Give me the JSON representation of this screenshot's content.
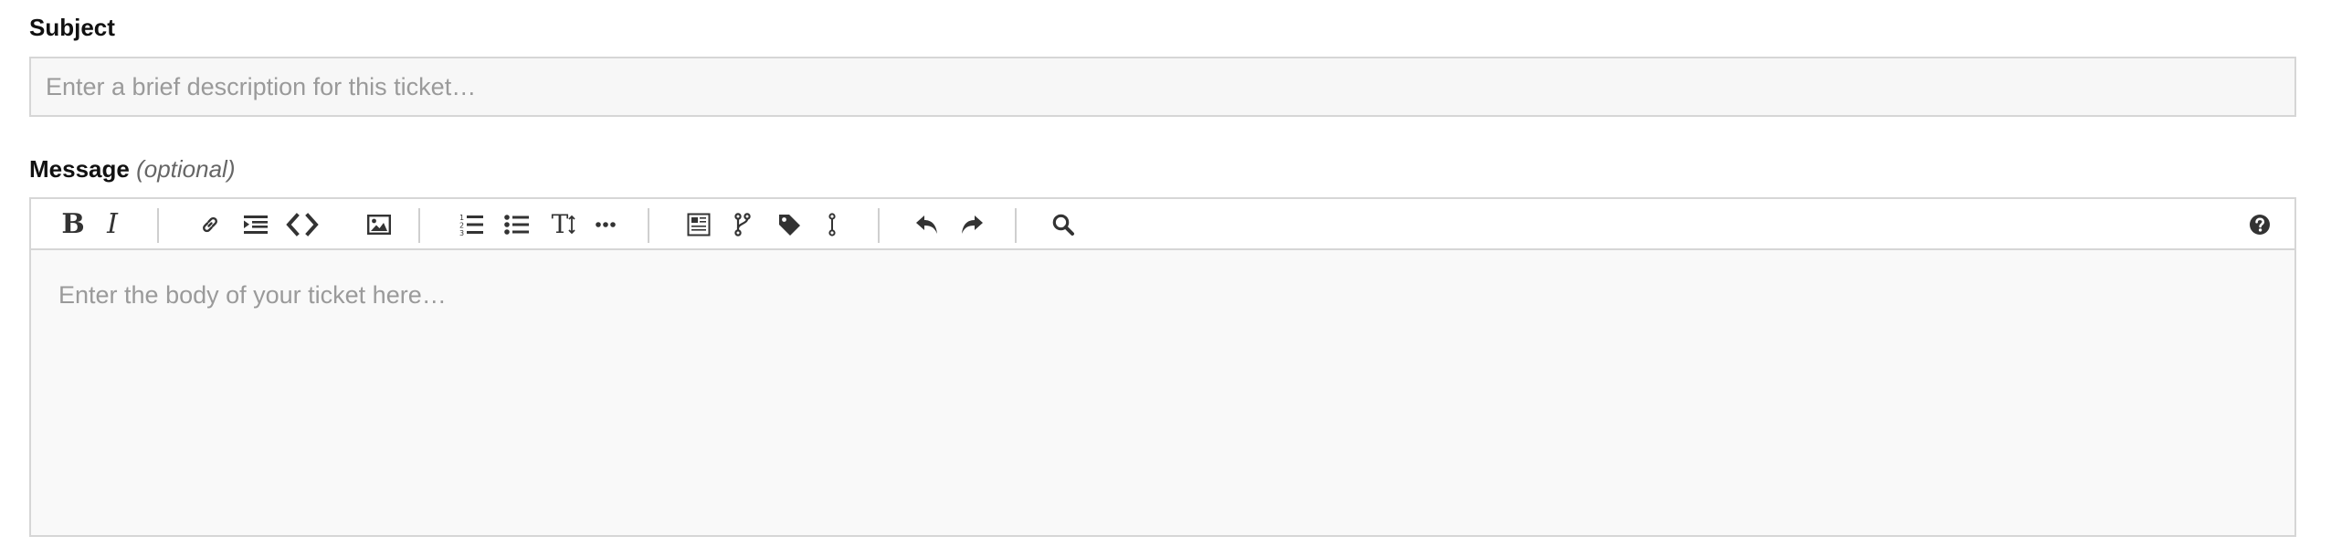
{
  "subject": {
    "label": "Subject",
    "placeholder": "Enter a brief description for this ticket…",
    "value": ""
  },
  "message": {
    "label": "Message",
    "optional": "(optional)",
    "placeholder": "Enter the body of your ticket here…",
    "value": ""
  },
  "toolbar": {
    "bold": "B",
    "italic": "I",
    "heading": "T",
    "buttons": [
      {
        "name": "bold",
        "icon": "bold-icon"
      },
      {
        "name": "italic",
        "icon": "italic-icon"
      },
      {
        "name": "link",
        "icon": "link-icon"
      },
      {
        "name": "blockquote",
        "icon": "blockquote-icon"
      },
      {
        "name": "code",
        "icon": "code-icon"
      },
      {
        "name": "image",
        "icon": "image-icon"
      },
      {
        "name": "ordered-list",
        "icon": "ordered-list-icon"
      },
      {
        "name": "bullet-list",
        "icon": "bullet-list-icon"
      },
      {
        "name": "heading",
        "icon": "text-size-icon"
      },
      {
        "name": "horizontal-rule",
        "icon": "ellipsis-icon"
      },
      {
        "name": "issue",
        "icon": "document-icon"
      },
      {
        "name": "merge-request",
        "icon": "branch-icon"
      },
      {
        "name": "label",
        "icon": "tag-icon"
      },
      {
        "name": "milestone",
        "icon": "milestone-icon"
      },
      {
        "name": "undo",
        "icon": "undo-icon"
      },
      {
        "name": "redo",
        "icon": "redo-icon"
      },
      {
        "name": "search",
        "icon": "search-icon"
      },
      {
        "name": "help",
        "icon": "question-icon"
      }
    ]
  }
}
